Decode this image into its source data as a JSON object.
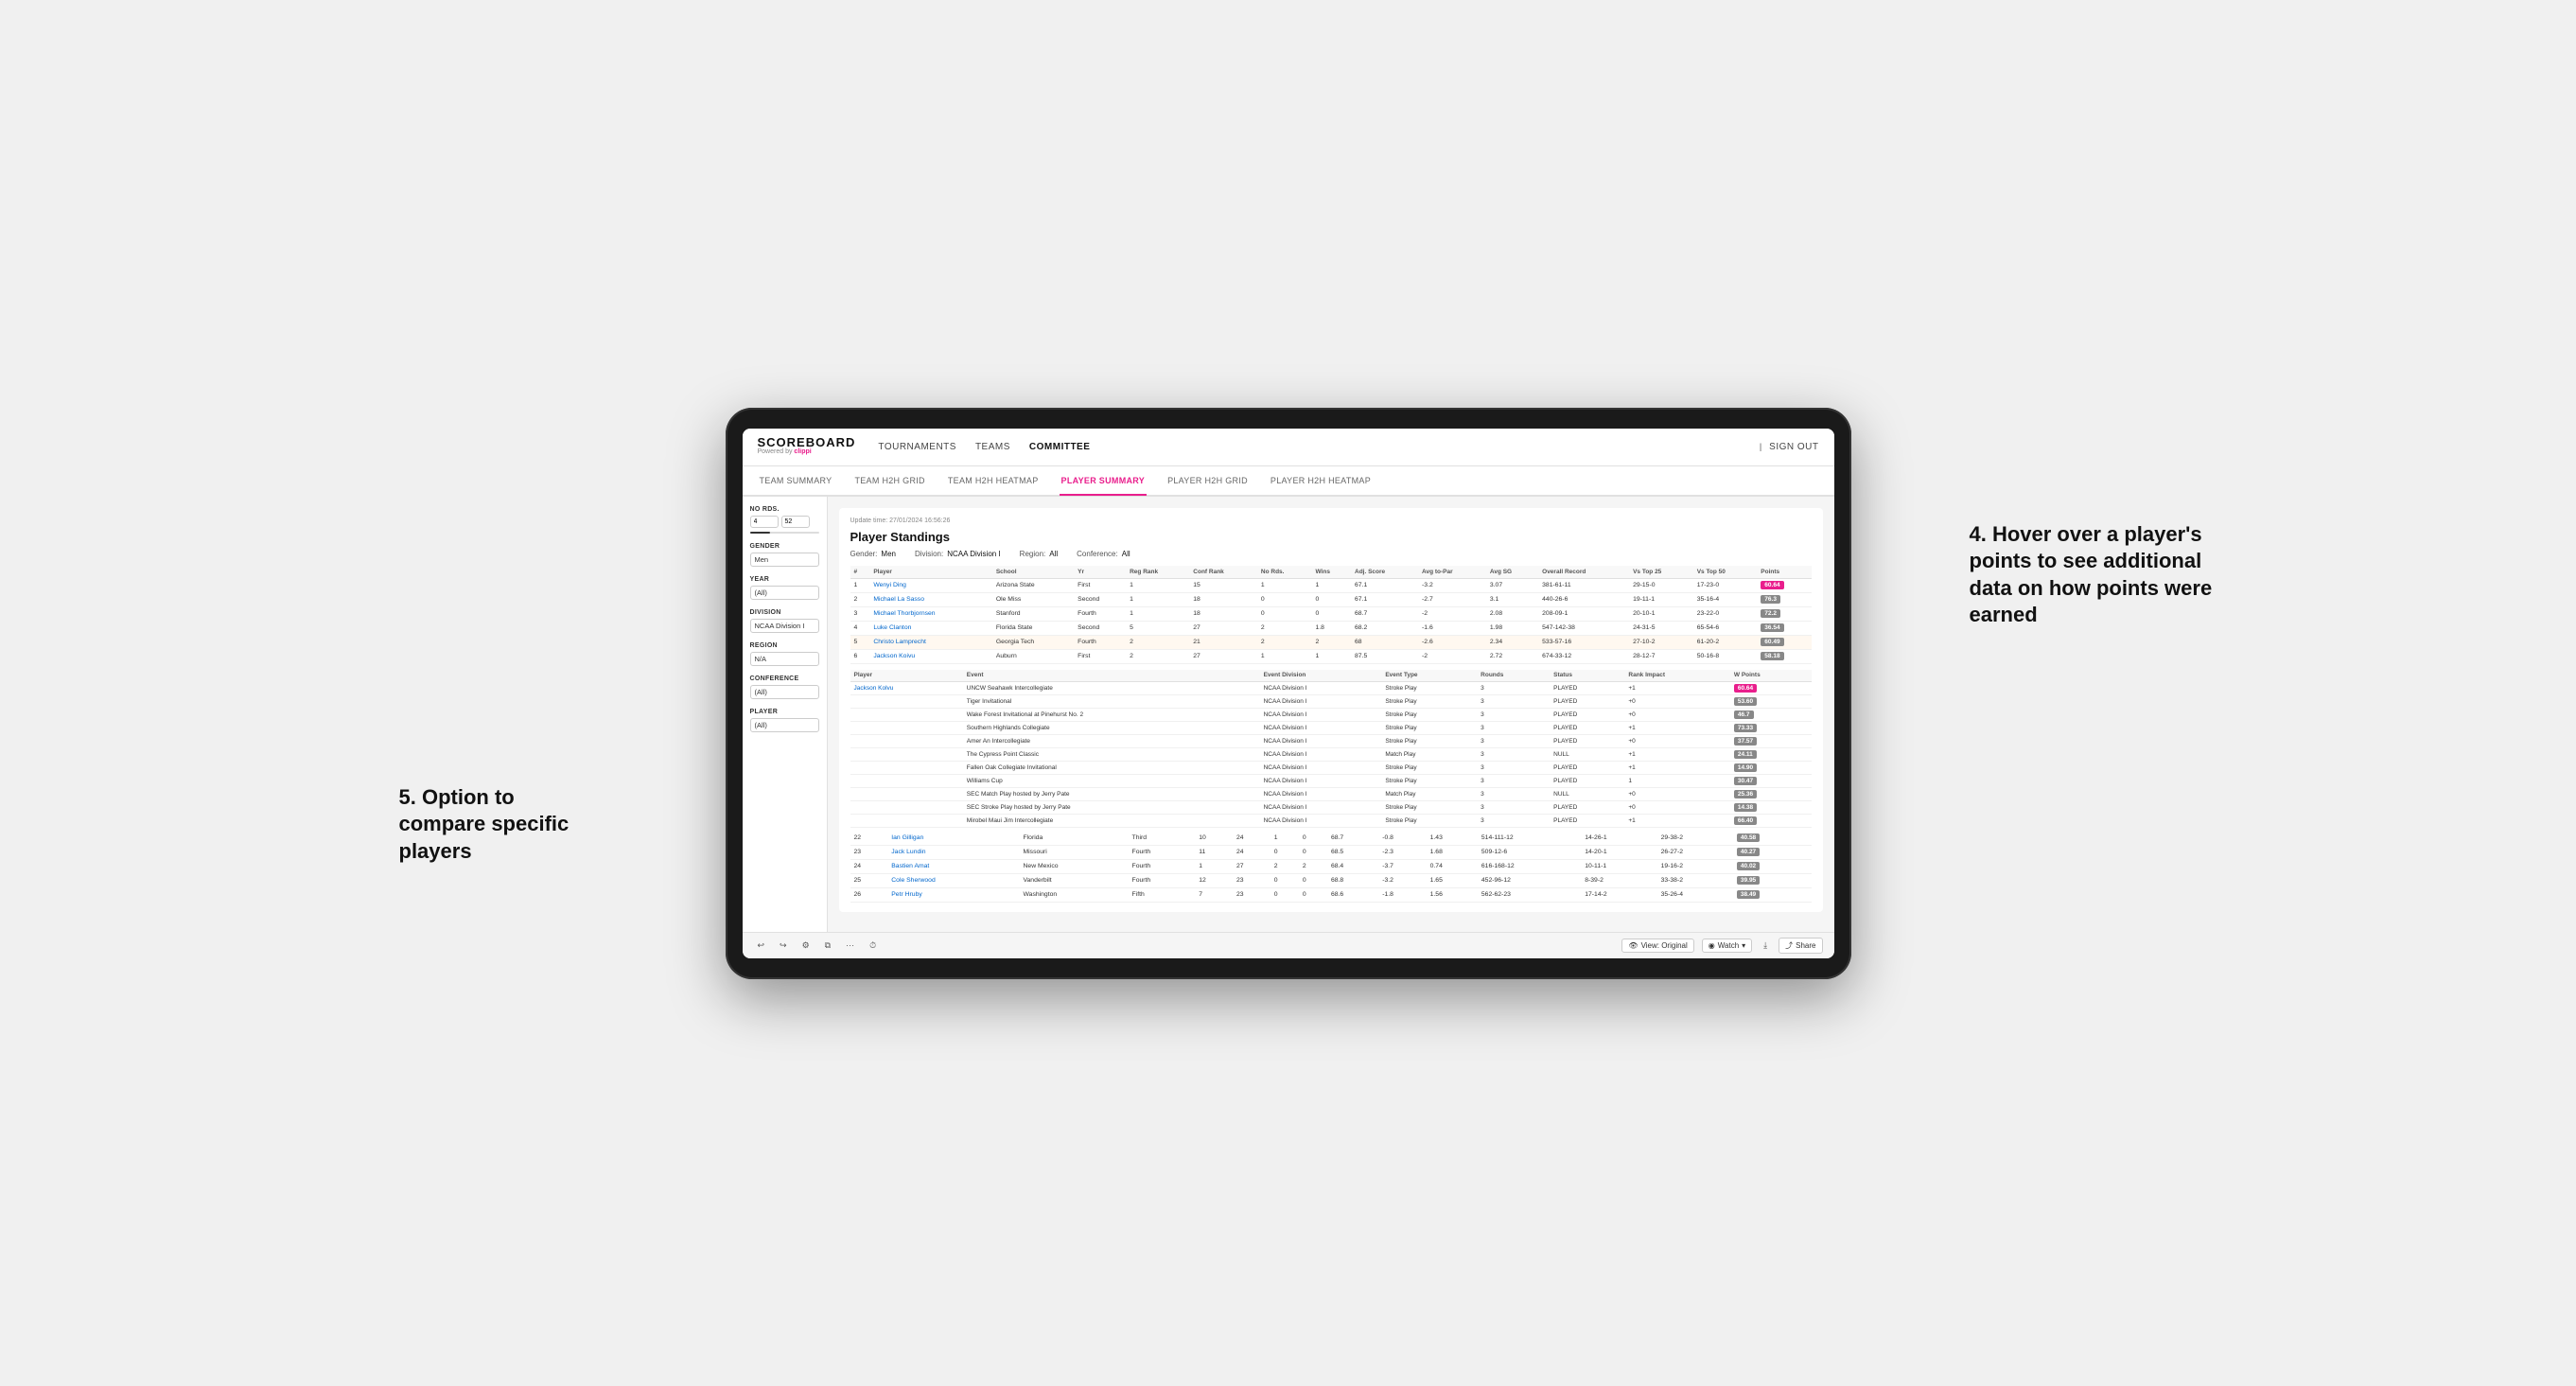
{
  "nav": {
    "logo": "SCOREBOARD",
    "powered_by": "Powered by clippi",
    "links": [
      "TOURNAMENTS",
      "TEAMS",
      "COMMITTEE"
    ],
    "active_link": "COMMITTEE",
    "sign_out": "Sign out"
  },
  "sub_nav": {
    "links": [
      "TEAM SUMMARY",
      "TEAM H2H GRID",
      "TEAM H2H HEATMAP",
      "PLAYER SUMMARY",
      "PLAYER H2H GRID",
      "PLAYER H2H HEATMAP"
    ],
    "active": "PLAYER SUMMARY"
  },
  "sidebar": {
    "no_rds_label": "No Rds.",
    "no_rds_min": "4",
    "no_rds_max": "52",
    "gender_label": "Gender",
    "gender_value": "Men",
    "year_label": "Year",
    "year_value": "(All)",
    "division_label": "Division",
    "division_value": "NCAA Division I",
    "region_label": "Region",
    "region_value": "N/A",
    "conference_label": "Conference",
    "conference_value": "(All)",
    "player_label": "Player",
    "player_value": "(All)"
  },
  "standings": {
    "title": "Player Standings",
    "update_time": "Update time: 27/01/2024 16:56:26",
    "filters": {
      "gender": "Men",
      "division": "NCAA Division I",
      "region": "All",
      "conference": "All"
    },
    "columns": [
      "#",
      "Player",
      "School",
      "Yr",
      "Reg Rank",
      "Conf Rank",
      "No Rds.",
      "Wins",
      "Adj. Score",
      "Avg to-Par",
      "Avg SG",
      "Overall Record",
      "Vs Top 25",
      "Vs Top 50",
      "Points"
    ],
    "rows": [
      {
        "rank": 1,
        "player": "Wenyi Ding",
        "school": "Arizona State",
        "yr": "First",
        "reg_rank": 1,
        "conf_rank": 15,
        "no_rds": 1,
        "wins": 1,
        "adj_score": 67.1,
        "avg_to_par": -3.2,
        "avg_sg": 3.07,
        "overall": "381-61-11",
        "vs_top25": "29-15-0",
        "vs_top50": "17-23-0",
        "points": "60.64",
        "highlight": true
      },
      {
        "rank": 2,
        "player": "Michael La Sasso",
        "school": "Ole Miss",
        "yr": "Second",
        "reg_rank": 1,
        "conf_rank": 18,
        "no_rds": 0,
        "wins": 0,
        "adj_score": 67.1,
        "avg_to_par": -2.7,
        "avg_sg": 3.1,
        "overall": "440-26-6",
        "vs_top25": "19-11-1",
        "vs_top50": "35-16-4",
        "points": "76.3"
      },
      {
        "rank": 3,
        "player": "Michael Thorbjornsen",
        "school": "Stanford",
        "yr": "Fourth",
        "reg_rank": 1,
        "conf_rank": 18,
        "no_rds": 0,
        "wins": 0,
        "adj_score": 68.7,
        "avg_to_par": -2.0,
        "avg_sg": 2.08,
        "overall": "208-09-1",
        "vs_top25": "20-10-1",
        "vs_top50": "23-22-0",
        "points": "72.2"
      },
      {
        "rank": 4,
        "player": "Luke Clanton",
        "school": "Florida State",
        "yr": "Second",
        "reg_rank": 5,
        "conf_rank": 27,
        "no_rds": 2,
        "wins": 1.8,
        "adj_score": 68.2,
        "avg_to_par": -1.6,
        "avg_sg": 1.98,
        "overall": "547-142-38",
        "vs_top25": "24-31-5",
        "vs_top50": "65-54-6",
        "points": "36.54"
      },
      {
        "rank": 5,
        "player": "Christo Lamprecht",
        "school": "Georgia Tech",
        "yr": "Fourth",
        "reg_rank": 2,
        "conf_rank": 21,
        "no_rds": 2,
        "wins": 2,
        "adj_score": 68.0,
        "avg_to_par": -2.6,
        "avg_sg": 2.34,
        "overall": "533-57-16",
        "vs_top25": "27-10-2",
        "vs_top50": "61-20-2",
        "points": "60.49",
        "hovered": true
      },
      {
        "rank": 6,
        "player": "Jackson Koivu",
        "school": "Auburn",
        "yr": "First",
        "reg_rank": 2,
        "conf_rank": 27,
        "no_rds": 1,
        "wins": 1,
        "adj_score": 87.5,
        "avg_to_par": -2.0,
        "avg_sg": 2.72,
        "overall": "674-33-12",
        "vs_top25": "28-12-7",
        "vs_top50": "50-16-8",
        "points": "58.18"
      }
    ]
  },
  "event_table": {
    "player_name": "Jackson Kolvu",
    "columns": [
      "Player",
      "Event",
      "Event Division",
      "Event Type",
      "Rounds",
      "Status",
      "Rank Impact",
      "W Points"
    ],
    "rows": [
      {
        "player": "",
        "event": "UNCW Seahawk Intercollegiate",
        "division": "NCAA Division I",
        "type": "Stroke Play",
        "rounds": 3,
        "status": "PLAYED",
        "rank_impact": "+1",
        "points": "60.64",
        "highlight": true
      },
      {
        "player": "",
        "event": "Tiger Invitational",
        "division": "NCAA Division I",
        "type": "Stroke Play",
        "rounds": 3,
        "status": "PLAYED",
        "rank_impact": "+0",
        "points": "53.60"
      },
      {
        "player": "",
        "event": "Wake Forest Invitational at Pinehurst No. 2",
        "division": "NCAA Division I",
        "type": "Stroke Play",
        "rounds": 3,
        "status": "PLAYED",
        "rank_impact": "+0",
        "points": "46.7"
      },
      {
        "player": "",
        "event": "Southern Highlands Collegiate",
        "division": "NCAA Division I",
        "type": "Stroke Play",
        "rounds": 3,
        "status": "PLAYED",
        "rank_impact": "+1",
        "points": "73.33"
      },
      {
        "player": "",
        "event": "Amer An Intercollegiate",
        "division": "NCAA Division I",
        "type": "Stroke Play",
        "rounds": 3,
        "status": "PLAYED",
        "rank_impact": "+0",
        "points": "37.57"
      },
      {
        "player": "",
        "event": "The Cypress Point Classic",
        "division": "NCAA Division I",
        "type": "Match Play",
        "rounds": 3,
        "status": "NULL",
        "rank_impact": "+1",
        "points": "24.11"
      },
      {
        "player": "",
        "event": "Fallen Oak Collegiate Invitational",
        "division": "NCAA Division I",
        "type": "Stroke Play",
        "rounds": 3,
        "status": "PLAYED",
        "rank_impact": "+1",
        "points": "14.90"
      },
      {
        "player": "",
        "event": "Williams Cup",
        "division": "NCAA Division I",
        "type": "Stroke Play",
        "rounds": 3,
        "status": "PLAYED",
        "rank_impact": "1",
        "points": "30.47"
      },
      {
        "player": "",
        "event": "SEC Match Play hosted by Jerry Pate",
        "division": "NCAA Division I",
        "type": "Match Play",
        "rounds": 3,
        "status": "NULL",
        "rank_impact": "+0",
        "points": "25.36"
      },
      {
        "player": "",
        "event": "SEC Stroke Play hosted by Jerry Pate",
        "division": "NCAA Division I",
        "type": "Stroke Play",
        "rounds": 3,
        "status": "PLAYED",
        "rank_impact": "+0",
        "points": "14.38"
      },
      {
        "player": "",
        "event": "Mirobel Maui Jim Intercollegiate",
        "division": "NCAA Division I",
        "type": "Stroke Play",
        "rounds": 3,
        "status": "PLAYED",
        "rank_impact": "+1",
        "points": "66.40"
      }
    ]
  },
  "more_rows": [
    {
      "rank": 22,
      "player": "Ian Gilligan",
      "school": "Florida",
      "yr": "Third",
      "reg_rank": 10,
      "conf_rank": 24,
      "no_rds": 1,
      "wins": 0,
      "adj_score": 68.7,
      "avg_to_par": -0.8,
      "avg_sg": 1.43,
      "overall": "514-111-12",
      "vs_top25": "14-26-1",
      "vs_top50": "29-38-2",
      "points": "40.58"
    },
    {
      "rank": 23,
      "player": "Jack Lundin",
      "school": "Missouri",
      "yr": "Fourth",
      "reg_rank": 11,
      "conf_rank": 24,
      "no_rds": 0,
      "wins": 0,
      "adj_score": 68.5,
      "avg_to_par": -2.3,
      "avg_sg": 1.68,
      "overall": "509-12-6",
      "vs_top25": "14-20-1",
      "vs_top50": "26-27-2",
      "points": "40.27"
    },
    {
      "rank": 24,
      "player": "Bastien Amat",
      "school": "New Mexico",
      "yr": "Fourth",
      "reg_rank": 1,
      "conf_rank": 27,
      "no_rds": 2,
      "wins": 2,
      "adj_score": 68.4,
      "avg_to_par": -3.7,
      "avg_sg": 0.74,
      "overall": "616-168-12",
      "vs_top25": "10-11-1",
      "vs_top50": "19-16-2",
      "points": "40.02"
    },
    {
      "rank": 25,
      "player": "Cole Sherwood",
      "school": "Vanderbilt",
      "yr": "Fourth",
      "reg_rank": 12,
      "conf_rank": 23,
      "no_rds": 0,
      "wins": 0,
      "adj_score": 68.8,
      "avg_to_par": -3.2,
      "avg_sg": 1.65,
      "overall": "452-96-12",
      "vs_top25": "8-39-2",
      "vs_top50": "33-38-2",
      "points": "39.95"
    },
    {
      "rank": 26,
      "player": "Petr Hruby",
      "school": "Washington",
      "yr": "Fifth",
      "reg_rank": 7,
      "conf_rank": 23,
      "no_rds": 0,
      "wins": 0,
      "adj_score": 68.6,
      "avg_to_par": -1.8,
      "avg_sg": 1.56,
      "overall": "562-62-23",
      "vs_top25": "17-14-2",
      "vs_top50": "35-26-4",
      "points": "38.49"
    }
  ],
  "toolbar": {
    "view_original": "View: Original",
    "watch": "Watch",
    "share": "Share"
  },
  "annotations": {
    "note4_title": "4. Hover over a player's points to see additional data on how points were earned",
    "note5_title": "5. Option to compare specific players"
  }
}
